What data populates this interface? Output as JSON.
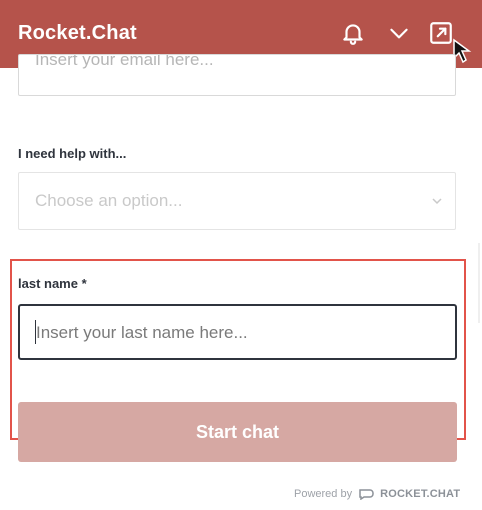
{
  "header": {
    "title": "Rocket.Chat"
  },
  "form": {
    "email_placeholder": "Insert your email here...",
    "help_label": "I need help with...",
    "help_placeholder": "Choose an option...",
    "last_name_label": "last name *",
    "last_name_placeholder": "Insert your last name here...",
    "start_chat_label": "Start chat"
  },
  "footer": {
    "powered_by": "Powered by",
    "brand": "ROCKET.CHAT"
  },
  "colors": {
    "header_bg": "#b5534b",
    "button_bg": "#d6a8a3",
    "highlight": "#e2534a"
  },
  "icons": {
    "notification": "bell-icon",
    "minimize": "chevron-down-icon",
    "popout": "external-link-icon",
    "select_arrow": "chevron-down-icon"
  }
}
